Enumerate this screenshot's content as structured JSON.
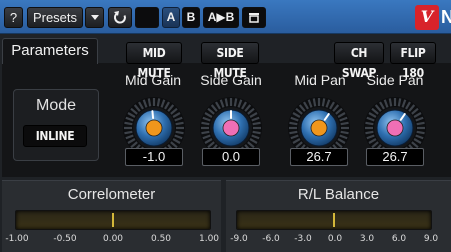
{
  "toolbar": {
    "help_label": "?",
    "presets_label": "Presets",
    "dropdown_icon": "chevron-down-icon",
    "reset_icon": "undo-icon",
    "a_label": "A",
    "b_label": "B",
    "a_to_b_label": "A▶B",
    "window_icon": "window-icon",
    "logo_text": "V",
    "logo_tail": "N"
  },
  "tabs": {
    "parameters": "Parameters"
  },
  "buttons": {
    "mid_mute": "MID MUTE",
    "side_mute": "SIDE MUTE",
    "ch_swap": "CH SWAP",
    "flip_180": "FLIP 180"
  },
  "mode": {
    "label": "Mode",
    "value": "INLINE"
  },
  "knobs": [
    {
      "label": "Mid Gain",
      "value": "-1.0",
      "color": "#f0961c",
      "level": 0.48
    },
    {
      "label": "Side Gain",
      "value": "0.0",
      "color": "#f06fb5",
      "level": 0.5
    },
    {
      "label": "Mid Pan",
      "value": "26.7",
      "color": "#f0961c",
      "level": 0.63
    },
    {
      "label": "Side Pan",
      "value": "26.7",
      "color": "#f06fb5",
      "level": 0.63
    }
  ],
  "correlometer": {
    "title": "Correlometer",
    "ticks": [
      "-1.00",
      "-0.50",
      "0.00",
      "0.50",
      "1.00"
    ],
    "value": 0.0
  },
  "balance": {
    "title": "R/L Balance",
    "ticks": [
      "-9.0",
      "-6.0",
      "-3.0",
      "0.0",
      "3.0",
      "6.0",
      "9.0"
    ],
    "value": 0.0
  },
  "colors": {
    "toolbar": "#3a78c0",
    "accent_orange": "#f0961c",
    "accent_pink": "#f06fb5",
    "logo": "#d8232a"
  }
}
